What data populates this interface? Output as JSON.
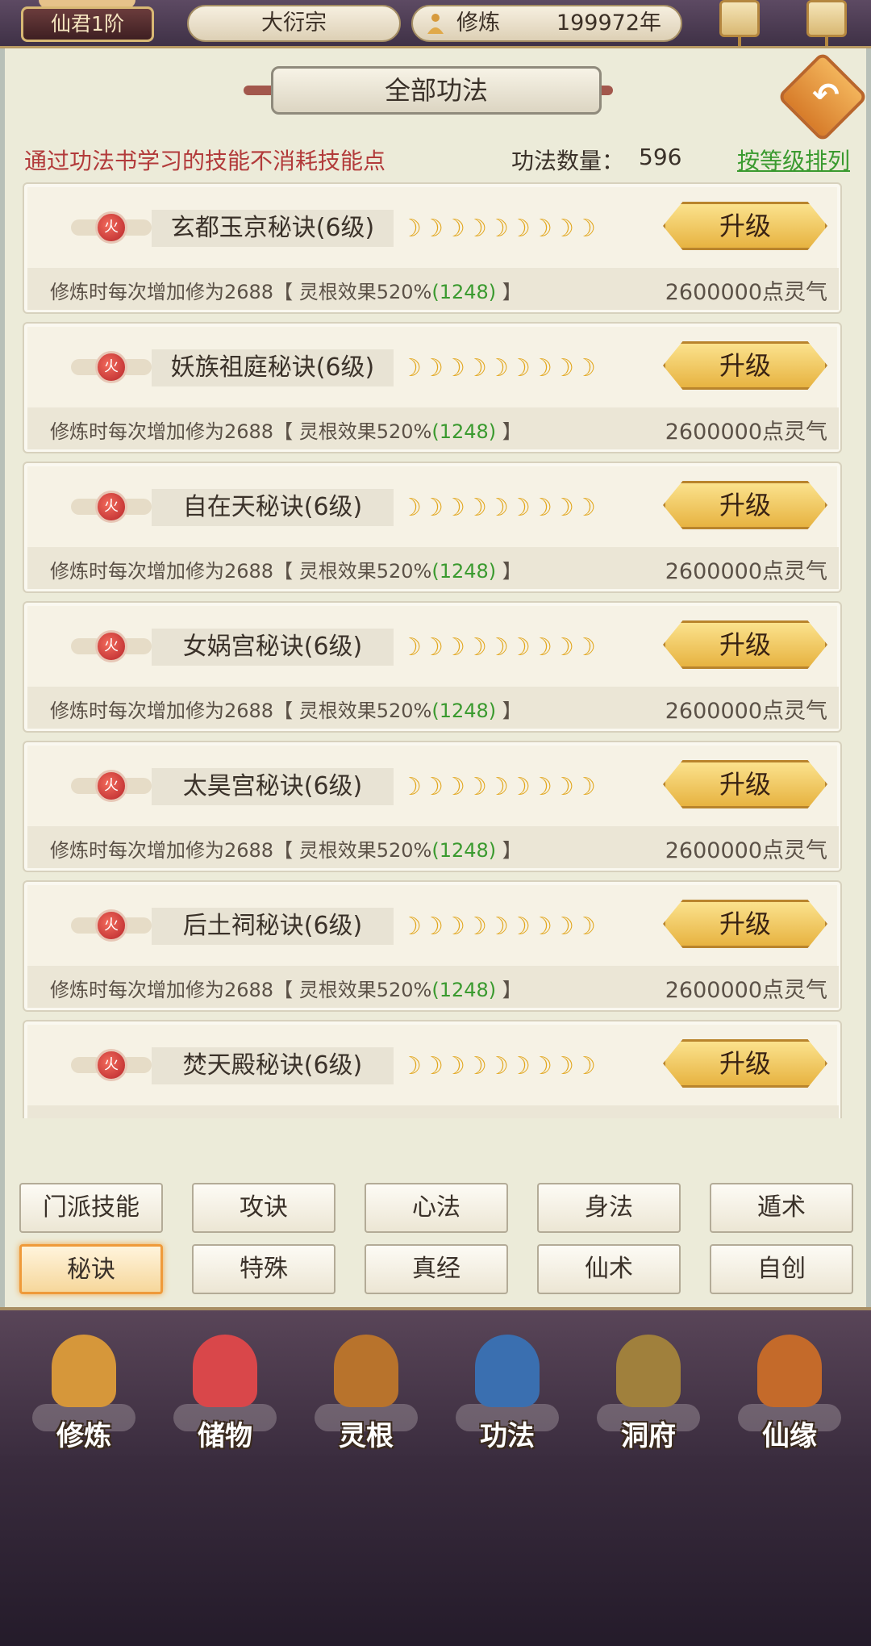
{
  "topbar": {
    "rank": "仙君1阶",
    "sect": "大衍宗",
    "cultivation_label": "修炼",
    "cultivation_value": "199972年",
    "cultivation_icon": "meditating-figure-icon"
  },
  "panel": {
    "title": "全部功法",
    "back_icon": "return-arrow-icon",
    "notice": "通过功法书学习的技能不消耗技能点",
    "count_label": "功法数量：",
    "count_value": "596",
    "sort_label": "按等级排列"
  },
  "skills": [
    {
      "name": "玄都玉京秘诀(6级)",
      "element": "火",
      "stars": 9,
      "button": "升级",
      "desc": "修炼时每次增加修为2688【 灵根效果520%",
      "desc_green": "(1248)",
      "desc_end": " 】",
      "cost": "2600000点灵气"
    },
    {
      "name": "妖族祖庭秘诀(6级)",
      "element": "火",
      "stars": 9,
      "button": "升级",
      "desc": "修炼时每次增加修为2688【 灵根效果520%",
      "desc_green": "(1248)",
      "desc_end": " 】",
      "cost": "2600000点灵气"
    },
    {
      "name": "自在天秘诀(6级)",
      "element": "火",
      "stars": 9,
      "button": "升级",
      "desc": "修炼时每次增加修为2688【 灵根效果520%",
      "desc_green": "(1248)",
      "desc_end": " 】",
      "cost": "2600000点灵气"
    },
    {
      "name": "女娲宫秘诀(6级)",
      "element": "火",
      "stars": 9,
      "button": "升级",
      "desc": "修炼时每次增加修为2688【 灵根效果520%",
      "desc_green": "(1248)",
      "desc_end": " 】",
      "cost": "2600000点灵气"
    },
    {
      "name": "太昊宫秘诀(6级)",
      "element": "火",
      "stars": 9,
      "button": "升级",
      "desc": "修炼时每次增加修为2688【 灵根效果520%",
      "desc_green": "(1248)",
      "desc_end": " 】",
      "cost": "2600000点灵气"
    },
    {
      "name": "后土祠秘诀(6级)",
      "element": "火",
      "stars": 9,
      "button": "升级",
      "desc": "修炼时每次增加修为2688【 灵根效果520%",
      "desc_green": "(1248)",
      "desc_end": " 】",
      "cost": "2600000点灵气"
    },
    {
      "name": "焚天殿秘诀(6级)",
      "element": "火",
      "stars": 9,
      "button": "升级",
      "desc": "",
      "desc_green": "",
      "desc_end": "",
      "cost": ""
    }
  ],
  "moon_glyph": "☽",
  "categories": [
    {
      "label": "门派技能",
      "active": false
    },
    {
      "label": "攻诀",
      "active": false
    },
    {
      "label": "心法",
      "active": false
    },
    {
      "label": "身法",
      "active": false
    },
    {
      "label": "遁术",
      "active": false
    },
    {
      "label": "秘诀",
      "active": true
    },
    {
      "label": "特殊",
      "active": false
    },
    {
      "label": "真经",
      "active": false
    },
    {
      "label": "仙术",
      "active": false
    },
    {
      "label": "自创",
      "active": false
    }
  ],
  "nav": [
    {
      "label": "修炼",
      "icon": "cultivator-icon",
      "color": "#d6973a"
    },
    {
      "label": "储物",
      "icon": "pouch-icon",
      "color": "#d9474a"
    },
    {
      "label": "灵根",
      "icon": "spirit-root-icon",
      "color": "#b8732c"
    },
    {
      "label": "功法",
      "icon": "book-icon",
      "color": "#3a6fb0"
    },
    {
      "label": "洞府",
      "icon": "pavilion-icon",
      "color": "#a0803c"
    },
    {
      "label": "仙缘",
      "icon": "gourd-icon",
      "color": "#c46a2a"
    }
  ]
}
